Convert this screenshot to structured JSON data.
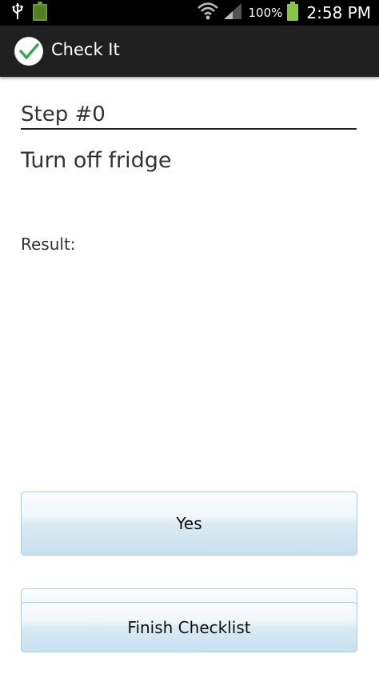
{
  "status_bar": {
    "battery_percent": "100%",
    "time": "2:58 PM",
    "left_icons": [
      "usb-icon",
      "battery-full-icon"
    ],
    "right_icons": [
      "wifi-icon",
      "signal-icon",
      "battery-icon"
    ],
    "battery_color": "#8bc34a"
  },
  "action_bar": {
    "title": "Check It",
    "icon": "checkmark-icon",
    "check_color": "#3aa655"
  },
  "step": {
    "heading": "Step #0",
    "description": "Turn off fridge",
    "result_label": "Result:"
  },
  "buttons": {
    "yes_label": "Yes",
    "finish_label": "Finish Checklist"
  }
}
